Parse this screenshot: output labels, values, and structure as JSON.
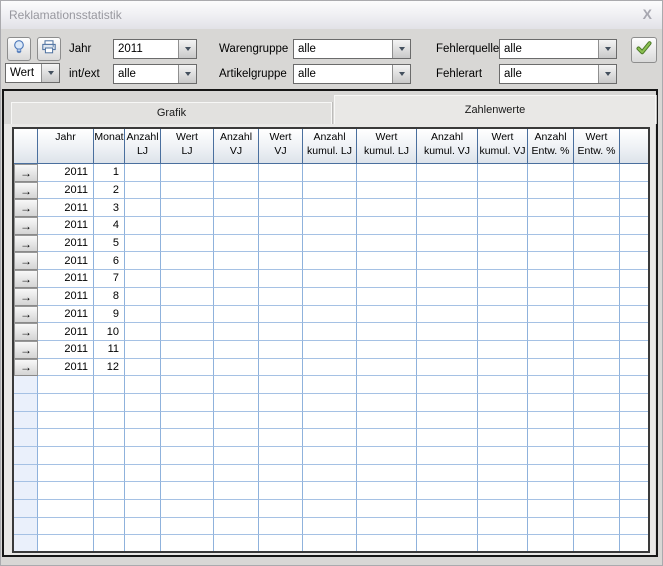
{
  "window": {
    "title": "Reklamationsstatistik",
    "close_glyph": "X"
  },
  "toolbar": {
    "hint_button": {
      "icon": "lightbulb"
    },
    "print_button": {
      "icon": "printer"
    },
    "apply_button": {
      "icon": "green-checkmark"
    },
    "mode_combo": {
      "value": "Wert"
    },
    "filters": [
      {
        "label": "Jahr",
        "value": "2011"
      },
      {
        "label": "Warengruppe",
        "value": "alle"
      },
      {
        "label": "Fehlerquelle",
        "value": "alle"
      },
      {
        "label": "int/ext",
        "value": "alle"
      },
      {
        "label": "Artikelgruppe",
        "value": "alle"
      },
      {
        "label": "Fehlerart",
        "value": "alle"
      }
    ]
  },
  "tabs": [
    {
      "label": "Grafik",
      "active": false
    },
    {
      "label": "Zahlenwerte",
      "active": true
    }
  ],
  "table": {
    "marker_glyph": "→",
    "columns": [
      "",
      "Jahr",
      "Monat",
      "Anzahl\nLJ",
      "Wert\nLJ",
      "Anzahl\nVJ",
      "Wert\nVJ",
      "Anzahl\nkumul. LJ",
      "Wert\nkumul. LJ",
      "Anzahl\nkumul. VJ",
      "Wert\nkumul. VJ",
      "Anzahl\nEntw. %",
      "Wert\nEntw. %",
      ""
    ],
    "rows": [
      {
        "jahr": "2011",
        "monat": "1"
      },
      {
        "jahr": "2011",
        "monat": "2"
      },
      {
        "jahr": "2011",
        "monat": "3"
      },
      {
        "jahr": "2011",
        "monat": "4"
      },
      {
        "jahr": "2011",
        "monat": "5"
      },
      {
        "jahr": "2011",
        "monat": "6"
      },
      {
        "jahr": "2011",
        "monat": "7"
      },
      {
        "jahr": "2011",
        "monat": "8"
      },
      {
        "jahr": "2011",
        "monat": "9"
      },
      {
        "jahr": "2011",
        "monat": "10"
      },
      {
        "jahr": "2011",
        "monat": "11"
      },
      {
        "jahr": "2011",
        "monat": "12"
      }
    ],
    "empty_row_count": 10
  },
  "colors": {
    "grid_line_blue": "#8fb2dc",
    "header_line_blue": "#4a6f9e",
    "icon_blue": "#4a76b8",
    "check_green": "#76b043",
    "toolbar_gray": "#d8d7d5",
    "panel_gray": "#e9e8e6"
  }
}
